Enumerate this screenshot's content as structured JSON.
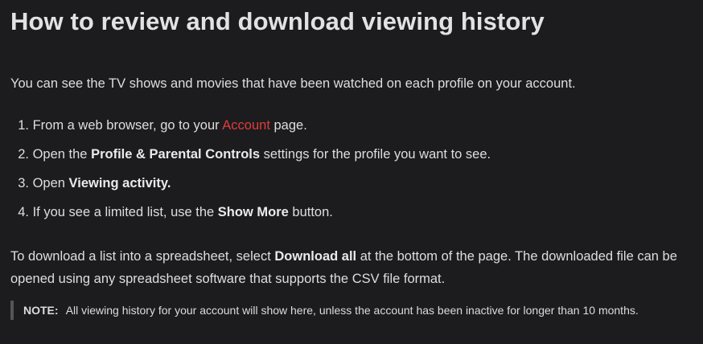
{
  "article": {
    "title": "How to review and download viewing history",
    "intro": "You can see the TV shows and movies that have been watched on each profile on your account.",
    "steps": [
      {
        "num": "1.",
        "pre": "From a web browser, go to your ",
        "link": "Account",
        "post": " page."
      },
      {
        "num": "2.",
        "pre": "Open the ",
        "bold": "Profile & Parental Controls",
        "post": " settings for the profile you want to see."
      },
      {
        "num": "3.",
        "pre": "Open ",
        "bold": "Viewing activity."
      },
      {
        "num": "4.",
        "pre": "If you see a limited list, use the ",
        "bold": "Show More",
        "post": " button."
      }
    ],
    "download": {
      "pre": "To download a list into a spreadsheet, select ",
      "bold": "Download all",
      "post": " at the bottom of the page. The downloaded file can be opened using any spreadsheet software that supports the CSV file format."
    },
    "note": {
      "label": "NOTE:",
      "text": "All viewing history for your account will show here, unless the account has been inactive for longer than 10 months."
    }
  }
}
